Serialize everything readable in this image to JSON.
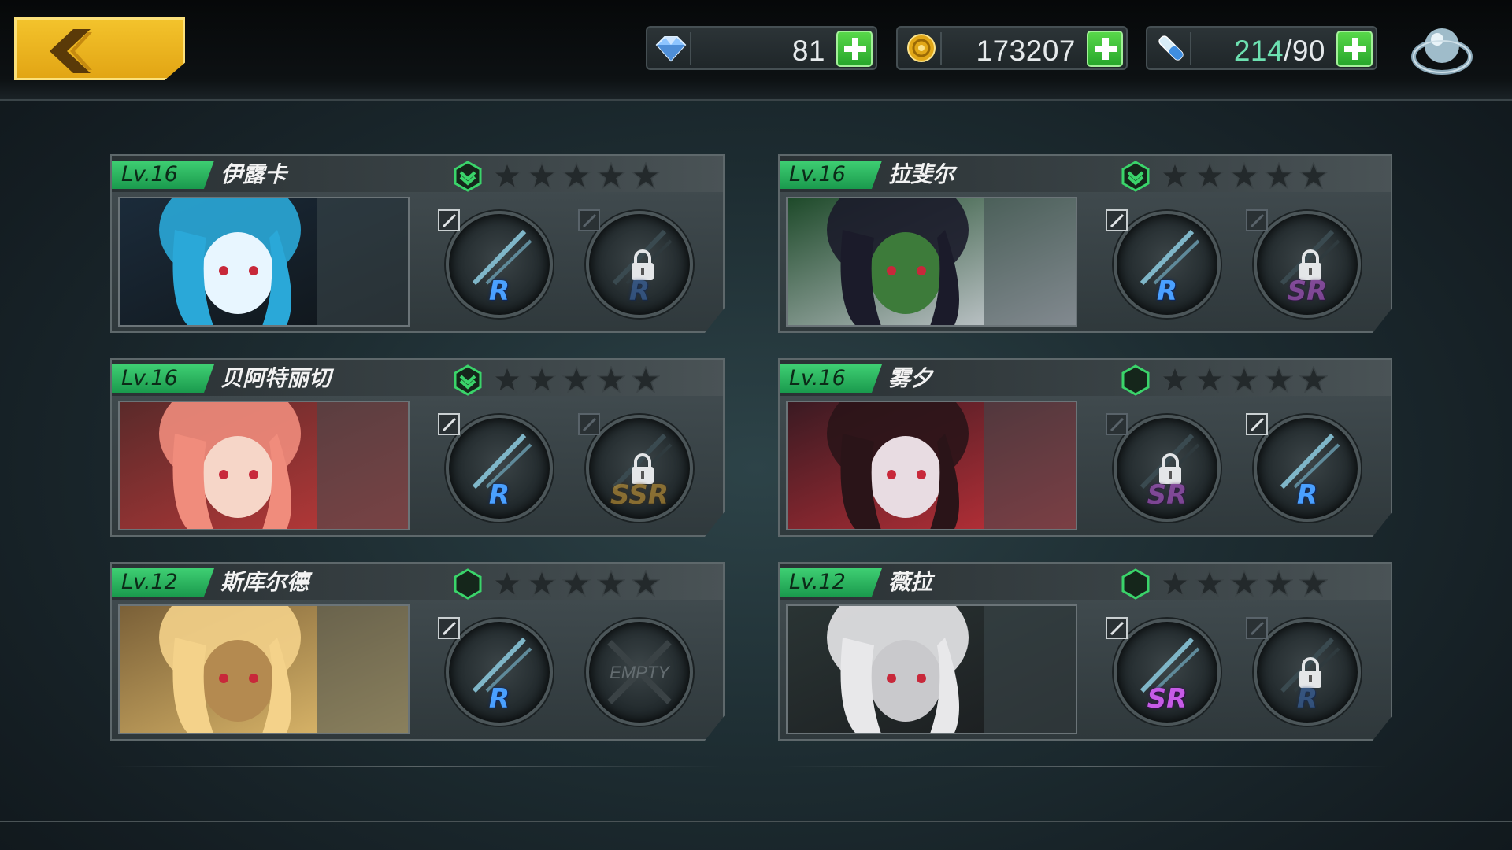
{
  "topbar": {
    "gems": "81",
    "gold": "173207",
    "stamina_current": "214",
    "stamina_max": "/90"
  },
  "icons": {
    "back": "chevron-left-icon",
    "gem": "diamond-icon",
    "gold": "gold-coin-icon",
    "stamina": "potion-vial-icon",
    "menu": "orb-icon",
    "plus": "plus-icon",
    "lock": "lock-icon",
    "edit": "edit-slash-icon",
    "rank": "green-hexagon-rank-icon",
    "star": "star-icon"
  },
  "colors": {
    "accent_yellow": "#f3c32c",
    "level_green": "#2fbf62",
    "rarity_R": "#4aa0ff",
    "rarity_SR": "#c65be6",
    "rarity_SSR": "#d9a233"
  },
  "characters": [
    {
      "level": "Lv.16",
      "name": "伊露卡",
      "stars": 5,
      "rank_up": true,
      "weapons": [
        {
          "rarity": "R",
          "locked": false
        },
        {
          "rarity": "R",
          "locked": true
        }
      ]
    },
    {
      "level": "Lv.16",
      "name": "拉斐尔",
      "stars": 5,
      "rank_up": true,
      "weapons": [
        {
          "rarity": "R",
          "locked": false
        },
        {
          "rarity": "SR",
          "locked": true
        }
      ]
    },
    {
      "level": "Lv.16",
      "name": "贝阿特丽切",
      "stars": 5,
      "rank_up": true,
      "weapons": [
        {
          "rarity": "R",
          "locked": false
        },
        {
          "rarity": "SSR",
          "locked": true
        }
      ]
    },
    {
      "level": "Lv.16",
      "name": "雾夕",
      "stars": 5,
      "rank_up": false,
      "weapons": [
        {
          "rarity": "SR",
          "locked": true
        },
        {
          "rarity": "R",
          "locked": false
        }
      ]
    },
    {
      "level": "Lv.12",
      "name": "斯库尔德",
      "stars": 5,
      "rank_up": false,
      "weapons": [
        {
          "rarity": "R",
          "locked": false
        },
        {
          "rarity": "",
          "locked": false,
          "empty": true,
          "label": "EMPTY"
        }
      ]
    },
    {
      "level": "Lv.12",
      "name": "薇拉",
      "stars": 5,
      "rank_up": false,
      "weapons": [
        {
          "rarity": "SR",
          "locked": false
        },
        {
          "rarity": "R",
          "locked": true
        }
      ]
    }
  ]
}
